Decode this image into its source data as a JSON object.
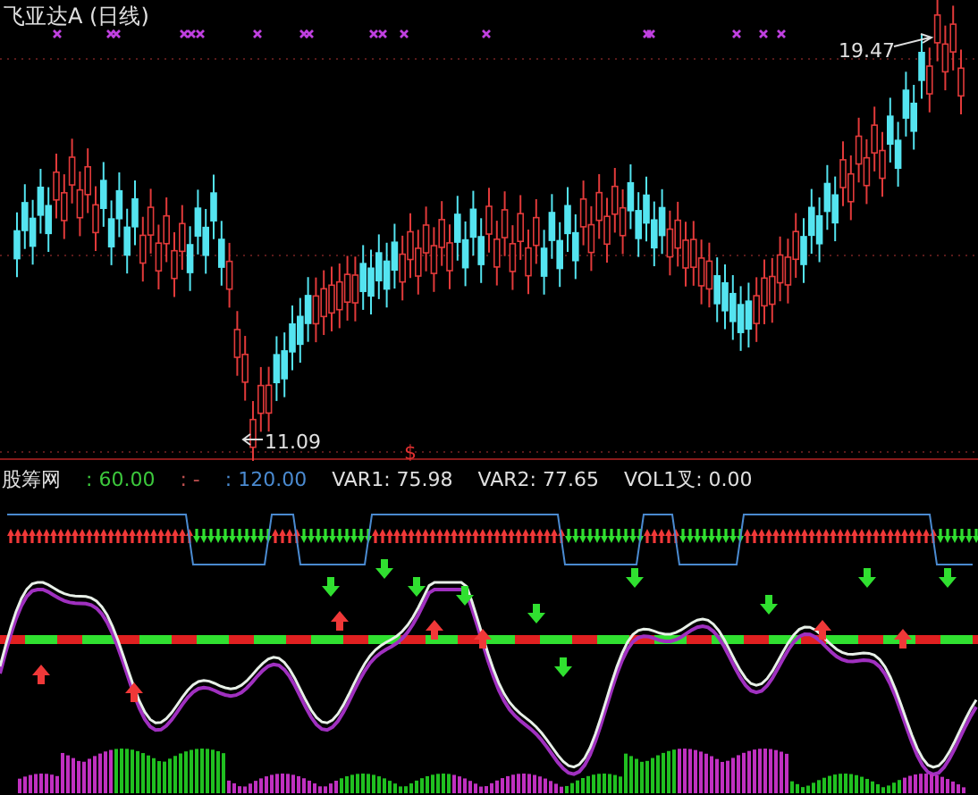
{
  "chart": {
    "title": "飞亚达A (日线)",
    "high_label": "19.47",
    "low_label": "11.09",
    "marker": "$"
  },
  "indicator": {
    "legend": [
      {
        "text": "股筹网",
        "color": "#e0e0e0"
      },
      {
        "text": ": 60.00",
        "color": "#3cc83c"
      },
      {
        "text": ":  -",
        "color": "#c05050"
      },
      {
        "text": ": 120.00",
        "color": "#4a8ad0"
      },
      {
        "text": "VAR1: 75.98",
        "color": "#e0e0e0"
      },
      {
        "text": "VAR2: 77.65",
        "color": "#e0e0e0"
      },
      {
        "text": "VOL1叉: 0.00",
        "color": "#e0e0e0"
      }
    ]
  }
}
